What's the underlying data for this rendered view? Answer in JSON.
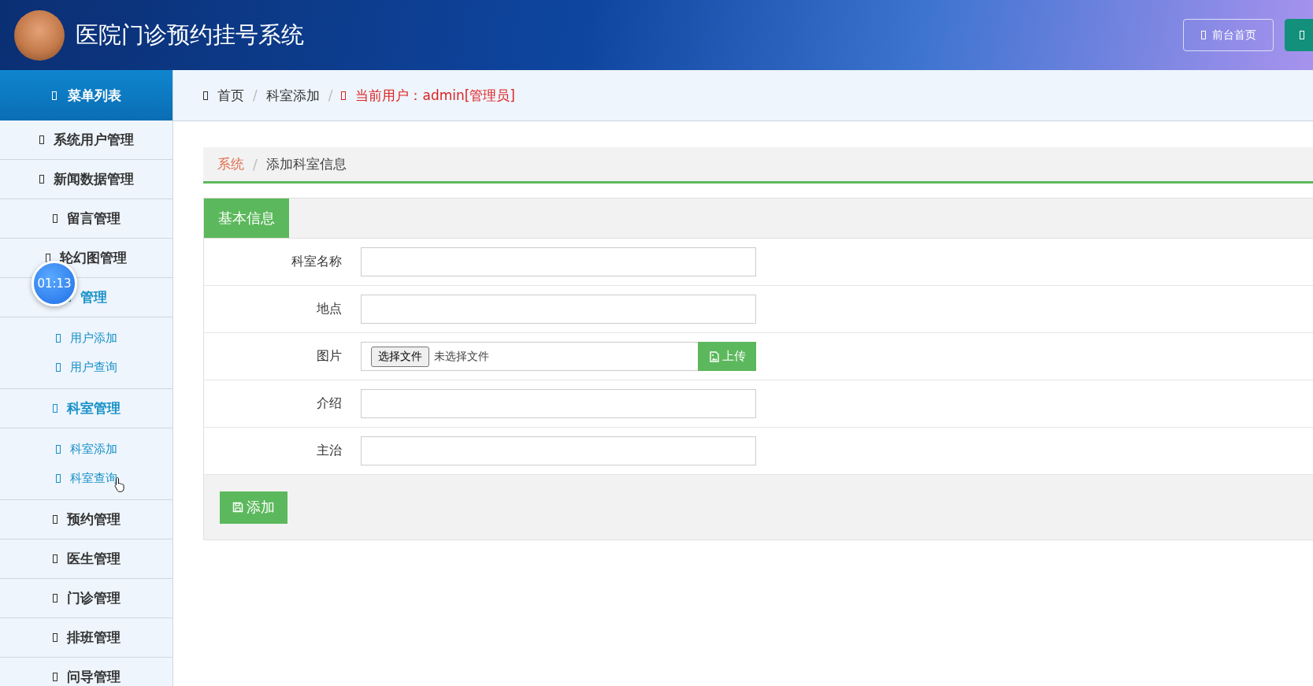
{
  "header": {
    "title": "医院门诊预约挂号系统",
    "buttons": [
      {
        "label": "前台首页",
        "kind": "outline"
      },
      {
        "kind": "solid"
      }
    ]
  },
  "sidebar": {
    "title": "菜单列表",
    "items": [
      {
        "label": "系统用户管理",
        "expanded": false
      },
      {
        "label": "新闻数据管理",
        "expanded": false
      },
      {
        "label": "留言管理",
        "expanded": false
      },
      {
        "label": "轮幻图管理",
        "expanded": false
      },
      {
        "label": "管理",
        "expanded": true,
        "children": [
          {
            "label": "用户添加"
          },
          {
            "label": "用户查询"
          }
        ]
      },
      {
        "label": "科室管理",
        "expanded": true,
        "children": [
          {
            "label": "科室添加"
          },
          {
            "label": "科室查询"
          }
        ]
      },
      {
        "label": "预约管理",
        "expanded": false
      },
      {
        "label": "医生管理",
        "expanded": false
      },
      {
        "label": "门诊管理",
        "expanded": false
      },
      {
        "label": "排班管理",
        "expanded": false
      },
      {
        "label": "问导管理",
        "expanded": false
      }
    ]
  },
  "timer": "01:13",
  "breadcrumb": {
    "separator": "/",
    "items": [
      "首页",
      "科室添加"
    ],
    "user": "当前用户：admin[管理员]"
  },
  "panel_breadcrumb": {
    "separator": "/",
    "items": [
      "系统",
      "添加科室信息"
    ]
  },
  "form": {
    "tab": "基本信息",
    "fields": [
      {
        "label": "科室名称",
        "kind": "text"
      },
      {
        "label": "地点",
        "kind": "text"
      },
      {
        "label": "图片",
        "kind": "file",
        "choose": "选择文件",
        "status": "未选择文件",
        "upload": "上传"
      },
      {
        "label": "介绍",
        "kind": "text"
      },
      {
        "label": "主治",
        "kind": "text"
      }
    ],
    "submit": "添加"
  }
}
